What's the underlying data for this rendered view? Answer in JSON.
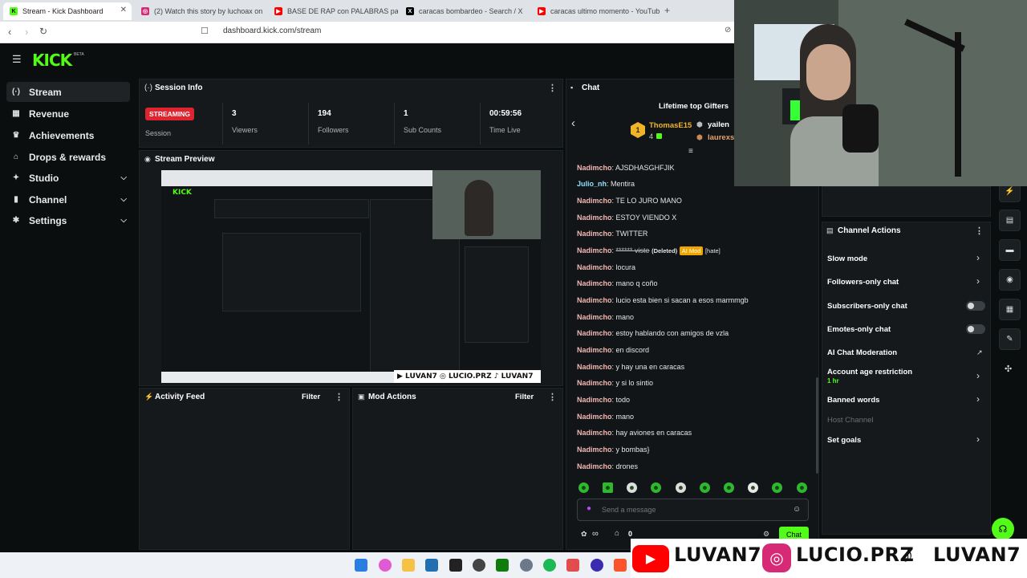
{
  "browser": {
    "tabs": [
      {
        "title": "Stream - Kick Dashboard",
        "color": "#53fc18",
        "glyph": "K"
      },
      {
        "title": "(2) Watch this story by luchoax on Ins",
        "color": "#d62976",
        "glyph": "◎"
      },
      {
        "title": "BASE DE RAP con PALABRAS par",
        "color": "#ff0000",
        "glyph": "▶"
      },
      {
        "title": "caracas bombardeo - Search / X",
        "color": "#000000",
        "glyph": "X"
      },
      {
        "title": "caracas ultimo momento - YouTube",
        "color": "#ff0000",
        "glyph": "▶"
      }
    ],
    "new_tab": "+",
    "url": "dashboard.kick.com/stream"
  },
  "brand": {
    "logo": "KICK",
    "badge": "BETA"
  },
  "sidebar": {
    "items": [
      {
        "label": "Stream",
        "icon": "broadcast-icon",
        "glyph": "(·)"
      },
      {
        "label": "Revenue",
        "icon": "money-icon",
        "glyph": "▦"
      },
      {
        "label": "Achievements",
        "icon": "trophy-icon",
        "glyph": "♛"
      },
      {
        "label": "Drops & rewards",
        "icon": "gift-icon",
        "glyph": "⌂"
      },
      {
        "label": "Studio",
        "icon": "studio-icon",
        "glyph": "✦"
      },
      {
        "label": "Channel",
        "icon": "channel-icon",
        "glyph": "▮"
      },
      {
        "label": "Settings",
        "icon": "gear-icon",
        "glyph": "✱"
      }
    ]
  },
  "session": {
    "title": "Session Info",
    "status": "STREAMING",
    "status_label": "Session",
    "stats": [
      {
        "value": "3",
        "label": "Viewers"
      },
      {
        "value": "194",
        "label": "Followers"
      },
      {
        "value": "1",
        "label": "Sub Counts"
      },
      {
        "value": "00:59:56",
        "label": "Time Live"
      }
    ]
  },
  "preview": {
    "title": "Stream Preview"
  },
  "activity": {
    "title": "Activity Feed",
    "filter": "Filter"
  },
  "mod": {
    "title": "Mod Actions",
    "filter": "Filter"
  },
  "chat": {
    "title": "Chat",
    "gifters_title": "Lifetime top Gifters",
    "gifters": [
      {
        "rank": "1",
        "name": "ThomasE15",
        "count": "4"
      },
      {
        "rank": "",
        "name": "yailen",
        "count": ""
      },
      {
        "rank": "",
        "name": "laurexs",
        "count": ""
      }
    ],
    "messages": [
      {
        "user": "Nadimcho",
        "text": "AJSDHASGHFJIK"
      },
      {
        "user": "Julio_nh",
        "text": "Mentira"
      },
      {
        "user": "Nadimcho",
        "text": "TE LO JURO MANO"
      },
      {
        "user": "Nadimcho",
        "text": "ESTOY VIENDO X"
      },
      {
        "user": "Nadimcho",
        "text": "TWITTER"
      },
      {
        "user": "Nadimcho",
        "text": "****** viste",
        "deleted": "(Deleted)",
        "tag": "AI Mod",
        "extra": "[hate]"
      },
      {
        "user": "Nadimcho",
        "text": "locura"
      },
      {
        "user": "Nadimcho",
        "text": "mano q coño"
      },
      {
        "user": "Nadimcho",
        "text": "lucio esta bien si sacan a esos marmmgb"
      },
      {
        "user": "Nadimcho",
        "text": "mano"
      },
      {
        "user": "Nadimcho",
        "text": "estoy hablando con amigos de vzla"
      },
      {
        "user": "Nadimcho",
        "text": "en discord"
      },
      {
        "user": "Nadimcho",
        "text": "y hay una en caracas"
      },
      {
        "user": "Nadimcho",
        "text": "y si lo sintio"
      },
      {
        "user": "Nadimcho",
        "text": "todo"
      },
      {
        "user": "Nadimcho",
        "text": "mano"
      },
      {
        "user": "Nadimcho",
        "text": "hay aviones en caracas"
      },
      {
        "user": "Nadimcho",
        "text": "y bombas}"
      },
      {
        "user": "Nadimcho",
        "text": "drones"
      }
    ],
    "placeholder": "Send a message",
    "points": "∞",
    "store_count": "0",
    "send": "Chat"
  },
  "channel_actions": {
    "title": "Channel Actions",
    "items": [
      {
        "label": "Slow mode",
        "control": "chevron"
      },
      {
        "label": "Followers-only chat",
        "control": "chevron"
      },
      {
        "label": "Subscribers-only chat",
        "control": "toggle"
      },
      {
        "label": "Emotes-only chat",
        "control": "toggle"
      },
      {
        "label": "AI Chat Moderation",
        "control": "external"
      },
      {
        "label": "Account age restriction",
        "sub": "1 hr",
        "control": "chevron"
      },
      {
        "label": "Banned words",
        "control": "chevron"
      },
      {
        "label": "Host Channel",
        "control": "none",
        "disabled": true
      },
      {
        "label": "Set goals",
        "control": "chevron"
      }
    ]
  },
  "right_rail": [
    "flash-icon",
    "document-icon",
    "chat-bubble-icon",
    "broadcast-icon",
    "layout-icon",
    "wrench-icon",
    "share-icon"
  ],
  "overlay": {
    "youtube": "LUVAN7",
    "instagram": "LUCIO.PRZ",
    "tiktok": "LUVAN7"
  },
  "colors": {
    "accent": "#53fc18",
    "live": "#e0242f",
    "panel": "#15191c",
    "bg": "#0b0e0f"
  }
}
